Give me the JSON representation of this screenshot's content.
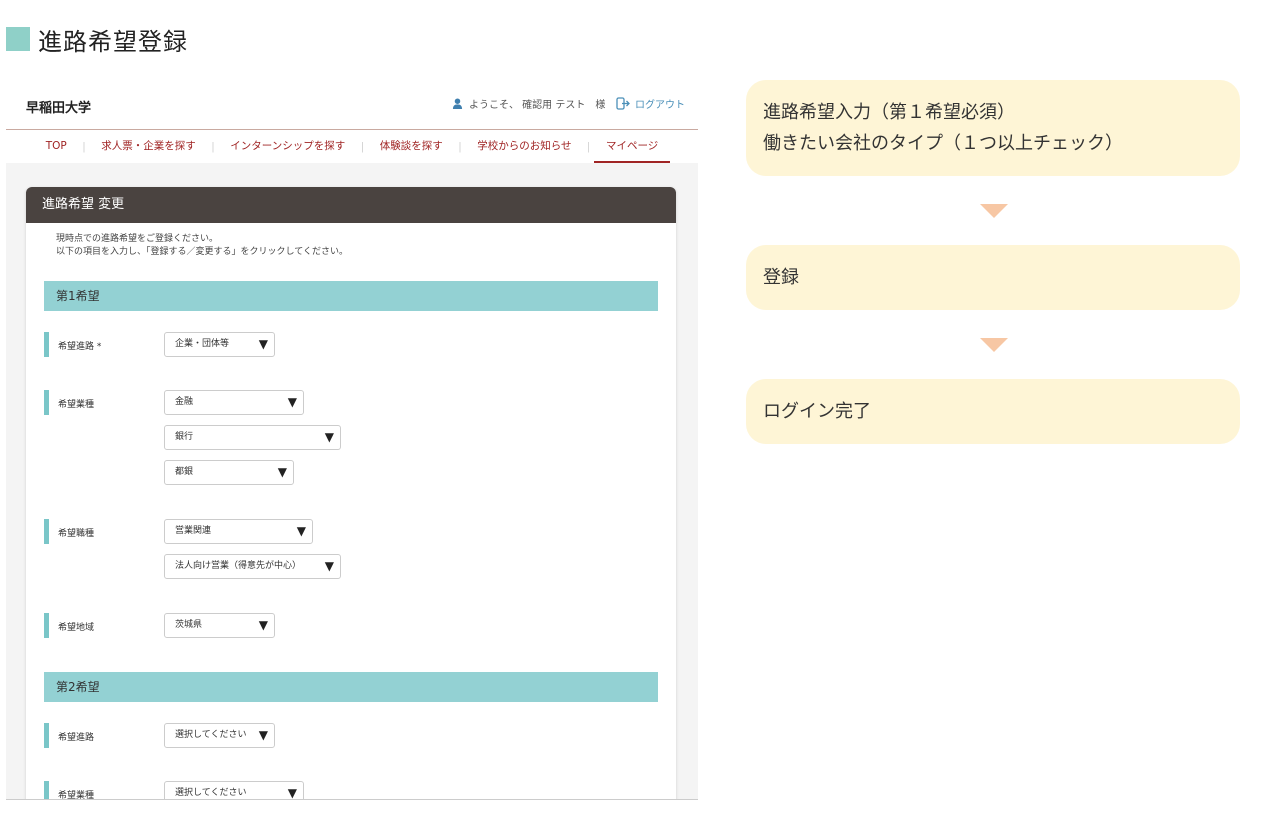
{
  "page": {
    "title": "進路希望登録"
  },
  "screenshot": {
    "logo": "早稲田大学",
    "welcome": "ようこそ、 確認用 テスト　様",
    "logout": "ログアウト",
    "nav": [
      "TOP",
      "求人票・企業を探す",
      "インターンシップを探す",
      "体験談を探す",
      "学校からのお知らせ",
      "マイページ"
    ],
    "nav_sep": "｜",
    "card_title": "進路希望 変更",
    "intro_line1": "現時点での進路希望をご登録ください。",
    "intro_line2": "以下の項目を入力し、「登録する／変更する」をクリックしてください。",
    "section1": "第1希望",
    "section2": "第2希望",
    "labels": {
      "course_required": "希望進路 *",
      "industry": "希望業種",
      "job": "希望職種",
      "region": "希望地域",
      "course": "希望進路"
    },
    "values": {
      "course": "企業・団体等",
      "industry1": "金融",
      "industry2": "銀行",
      "industry3": "都銀",
      "job1": "営業関連",
      "job2": "法人向け営業（得意先が中心）",
      "region": "茨城県",
      "course2": "選択してください",
      "industry_s2": "選択してください"
    },
    "dropdown_arrow": "▼"
  },
  "flow": {
    "step1_line1": "進路希望入力（第１希望必須）",
    "step1_line2": "働きたい会社のタイプ（１つ以上チェック）",
    "step2": "登録",
    "step3": "ログイン完了"
  },
  "colors": {
    "heading_square": "#8fd0c8",
    "nav_text": "#a02424",
    "card_header": "#4a4340",
    "section_bar": "#93d1d3",
    "flow_box": "#fef5d6",
    "flow_arrow": "#f7c7a4"
  }
}
